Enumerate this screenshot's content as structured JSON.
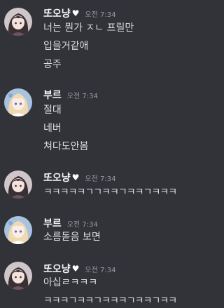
{
  "messages": [
    {
      "author": "또오냥",
      "author_badge": "heart-icon",
      "time": "오전 7:34",
      "lines": [
        "너는 뭔가 ㅈㄴ 프릴만",
        "입을거같애",
        "공주"
      ]
    },
    {
      "author": "부르",
      "time": "오전 7:34",
      "lines": [
        "절대",
        "네버",
        "쳐다도안봄"
      ]
    },
    {
      "author": "또오냥",
      "author_badge": "heart-icon",
      "time": "오전 7:34",
      "lines": [
        "ㅋㅋㅋㅋㅋㄱㄱㅋㅋㄱㅋㅋㄱㅋㅋㅋ"
      ]
    },
    {
      "author": "부르",
      "time": "오전 7:34",
      "lines": [
        "소름돋음 보면"
      ]
    },
    {
      "author": "또오냥",
      "author_badge": "heart-icon",
      "time": "오전 7:34",
      "lines": [
        "아십ㄹㅋㅋㅋ",
        "ㅋㅋㅋㄱㅋㅋㄱㅋㅋㅋㄱㅋㅋㄱㅋㅋ"
      ]
    }
  ],
  "colors": {
    "background": "#313338",
    "username": "#f2f3f5",
    "timestamp": "#949ba4",
    "text": "#dbdee1"
  }
}
